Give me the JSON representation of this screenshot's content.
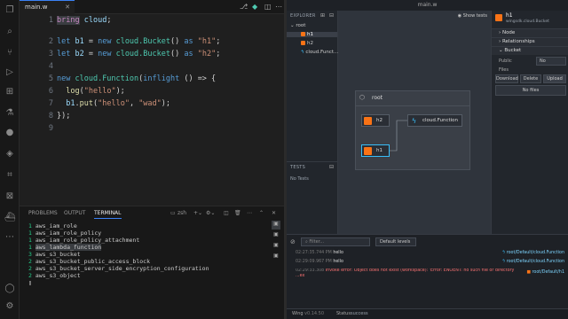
{
  "editor": {
    "tab_label": "main.w",
    "lines": [
      {
        "n": "1"
      },
      {
        "n": "2"
      },
      {
        "n": "3"
      },
      {
        "n": "4"
      },
      {
        "n": "5"
      },
      {
        "n": "6"
      },
      {
        "n": "7"
      },
      {
        "n": "8"
      },
      {
        "n": "9"
      }
    ]
  },
  "code": {
    "l1_kw": "bring",
    "l1_mod": "cloud",
    "l3_let": "let",
    "l3_var": "b1",
    "l3_new": "new",
    "l3_type": "cloud.Bucket",
    "l3_as": "as",
    "l3_str": "\"h1\"",
    "l4_let": "let",
    "l4_var": "b2",
    "l4_new": "new",
    "l4_type": "cloud.Bucket",
    "l4_as": "as",
    "l4_str": "\"h2\"",
    "l6_new": "new",
    "l6_type": "cloud.Function",
    "l6_kw": "inflight",
    "l7_fn": "log",
    "l7_str": "\"hello\"",
    "l8_obj": "b1",
    "l8_fn": "put",
    "l8_s1": "\"hello\"",
    "l8_s2": "\"wad\"",
    "l9": "});"
  },
  "panel": {
    "tabs": [
      "PROBLEMS",
      "OUTPUT",
      "TERMINAL"
    ],
    "shell": "zsh",
    "terminal_lines": [
      {
        "num": "1",
        "text": "aws_iam_role"
      },
      {
        "num": "1",
        "text": "aws_iam_role_policy"
      },
      {
        "num": "1",
        "text": "aws_iam_role_policy_attachment"
      },
      {
        "num": "1",
        "text": "aws_lambda_function"
      },
      {
        "num": "3",
        "text": "aws_s3_bucket"
      },
      {
        "num": "2",
        "text": "aws_s3_bucket_public_access_block"
      },
      {
        "num": "2",
        "text": "aws_s3_bucket_server_side_encryption_configuration"
      },
      {
        "num": "2",
        "text": "aws_s3_object"
      }
    ]
  },
  "console": {
    "title": "main.w",
    "explorer_label": "EXPLORER",
    "show_tests": "Show tests",
    "tree": [
      "root",
      "h1",
      "h2",
      "cloud.Funct..."
    ],
    "tests_label": "TESTS",
    "no_tests": "No Tests",
    "graph": {
      "root": "root",
      "h2": "h2",
      "h1": "h1",
      "function": "cloud.Function"
    },
    "inspector": {
      "name": "h1",
      "type": "wingsdk.cloud.Bucket",
      "node_section": "Node",
      "relationships_section": "Relationships",
      "bucket_section": "Bucket",
      "public_label": "Public",
      "public_value": "No",
      "files_label": "Files",
      "buttons": [
        "Download",
        "Delete",
        "Upload"
      ],
      "no_files": "No files"
    },
    "logs": {
      "filter_placeholder": "Filter...",
      "level": "Default levels",
      "entries": [
        {
          "time": "02:27:35.744 PM",
          "msg": "hello",
          "src": "root/Default/cloud.Function"
        },
        {
          "time": "02:29:09.967 PM",
          "msg": "hello",
          "src": "root/Default/cloud.Function"
        },
        {
          "time": "02:29:33.308",
          "msg": "Invoke error: Object does not exist (workspace): 'Error: ENOENT: no such file or directory",
          "src": "root/Default/h1"
        }
      ],
      "err_suffix": "...ex"
    },
    "status": {
      "app": "Wing",
      "version": "v0.14.50",
      "status_label": "Status:",
      "status_value": "success"
    }
  },
  "colors": {
    "accent": "#3b82f6",
    "bucket": "#f97316",
    "function": "#38bdf8",
    "error": "#f87171"
  }
}
